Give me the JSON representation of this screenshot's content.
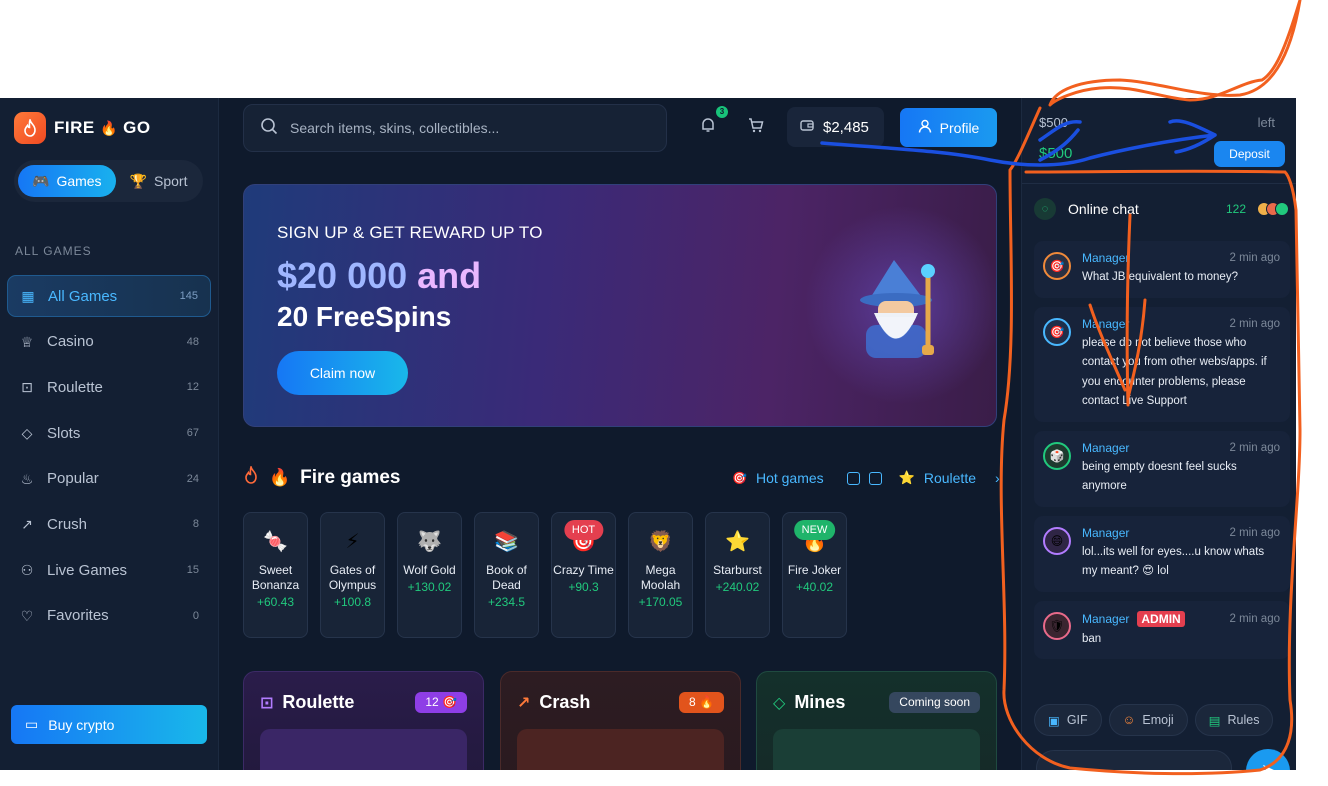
{
  "brand": {
    "name_a": "FIRE",
    "name_b": "GO"
  },
  "modes": [
    {
      "label": "Games",
      "icon": "gamepad-icon"
    },
    {
      "label": "Sport",
      "icon": "trophy-icon"
    }
  ],
  "sidebar": {
    "section": "ALL GAMES",
    "items": [
      {
        "label": "All Games",
        "count": "145",
        "icon": "grid-icon"
      },
      {
        "label": "Casino",
        "count": "48",
        "icon": "crown-icon"
      },
      {
        "label": "Roulette",
        "count": "12",
        "icon": "roulette-icon"
      },
      {
        "label": "Slots",
        "count": "67",
        "icon": "diamond-icon"
      },
      {
        "label": "Popular",
        "count": "24",
        "icon": "flame-icon"
      },
      {
        "label": "Crush",
        "count": "8",
        "icon": "trend-icon"
      },
      {
        "label": "Live Games",
        "count": "15",
        "icon": "users-icon"
      },
      {
        "label": "Favorites",
        "count": "0",
        "icon": "heart-icon"
      }
    ],
    "buy_crypto": "Buy crypto"
  },
  "header": {
    "search_placeholder": "Search items, skins, collectibles...",
    "notif_count": "3",
    "balance": "$2,485",
    "profile": "Profile"
  },
  "banner": {
    "subtitle": "SIGN UP & GET REWARD UP TO",
    "amount": "$20 000",
    "and": "and",
    "spins": "20 FreeSpins",
    "cta": "Claim now"
  },
  "fire_games": {
    "title": "Fire games",
    "links": {
      "hot": "Hot games",
      "roulette": "Roulette"
    },
    "cards": [
      {
        "name": "Sweet Bonanza",
        "value": "+60.43",
        "icon": "🍬"
      },
      {
        "name": "Gates of Olympus",
        "value": "+100.8",
        "icon": "⚡"
      },
      {
        "name": "Wolf Gold",
        "value": "+130.02",
        "icon": "🐺"
      },
      {
        "name": "Book of Dead",
        "value": "+234.5",
        "icon": "📚"
      },
      {
        "name": "Crazy Time",
        "value": "+90.3",
        "icon": "🎯",
        "tag": "HOT"
      },
      {
        "name": "Mega Moolah",
        "value": "+170.05",
        "icon": "🦁"
      },
      {
        "name": "Starburst",
        "value": "+240.02",
        "icon": "⭐"
      },
      {
        "name": "Fire Joker",
        "value": "+40.02",
        "icon": "🔥",
        "tag": "NEW"
      }
    ]
  },
  "categories": [
    {
      "title": "Roulette",
      "badge": "12 🎯"
    },
    {
      "title": "Crash",
      "badge": "8 🔥"
    },
    {
      "title": "Mines",
      "badge": "Coming soon"
    }
  ],
  "wallet_panel": {
    "balance_a": "$500",
    "balance_b": "$500",
    "left": "left",
    "deposit": "Deposit"
  },
  "chat": {
    "title": "Online chat",
    "online": "122",
    "messages": [
      {
        "name": "Manager",
        "time": "2 min ago",
        "text": "What JB equivalent to money?",
        "admin": ""
      },
      {
        "name": "Manager",
        "time": "2 min ago",
        "text": "please do not believe those who contact you from other webs/apps. if you encounter problems, please contact Live Support",
        "admin": ""
      },
      {
        "name": "Manager",
        "time": "2 min ago",
        "text": "being empty doesnt feel sucks anymore",
        "admin": ""
      },
      {
        "name": "Manager",
        "time": "2 min ago",
        "text": "lol...its well for eyes....u know whats my meant? 😍 lol",
        "admin": ""
      },
      {
        "name": "Manager",
        "time": "2 min ago",
        "text": "ban",
        "admin": "ADMIN"
      }
    ],
    "actions": {
      "gif": "GIF",
      "emoji": "Emoji",
      "rules": "Rules"
    }
  }
}
